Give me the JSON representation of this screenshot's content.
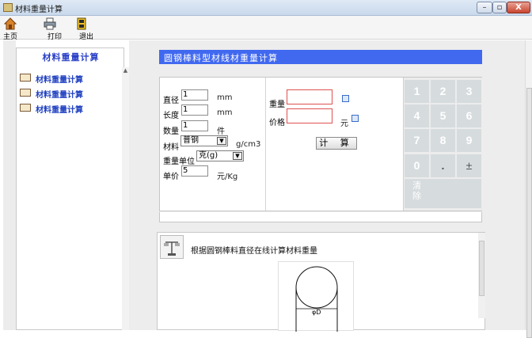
{
  "window": {
    "title": "材料重量计算",
    "minimize_glyph": "–",
    "restore_glyph": "▫",
    "close_glyph": "X"
  },
  "toolbar": {
    "home_label": "主页",
    "print_label": "打印",
    "exit_label": "退出"
  },
  "sidebar": {
    "heading": "材料重量计算",
    "items": [
      {
        "label": "材料重量计算"
      },
      {
        "label": "材料重量计算"
      },
      {
        "label": "材料重量计算"
      }
    ]
  },
  "main": {
    "header": "圆钢棒料型材线材重量计算",
    "fields": {
      "diameter_label": "直径",
      "diameter_value": "1",
      "diameter_unit": "mm",
      "length_label": "长度",
      "length_value": "1",
      "length_unit": "mm",
      "quantity_label": "数量",
      "quantity_value": "1",
      "quantity_unit": "件",
      "material_label": "材料",
      "material_value": "普钢",
      "density_unit": "g/cm3",
      "weight_unit_label": "重量单位",
      "weight_unit_value": "克(g)",
      "unit_price_label": "单价",
      "unit_price_value": "5",
      "unit_price_unit": "元/Kg"
    },
    "results": {
      "weight_label": "重量",
      "weight_value": "",
      "price_label": "价格",
      "price_value": "",
      "price_unit": "元",
      "calc_button": "计 算"
    },
    "keypad": {
      "keys": [
        "1",
        "2",
        "3",
        "4",
        "5",
        "6",
        "7",
        "8",
        "9",
        "0",
        ".",
        "±"
      ],
      "clear_line1": "清",
      "clear_line2": "除"
    }
  },
  "info": {
    "description": "根据圆钢棒料直径在线计算材料重量",
    "diagram_label": "φD"
  },
  "colors": {
    "header_blue": "#4169f0",
    "link_blue": "#1e3fc0",
    "key_bg": "#d6dbde",
    "result_border_red": "#e05050"
  }
}
